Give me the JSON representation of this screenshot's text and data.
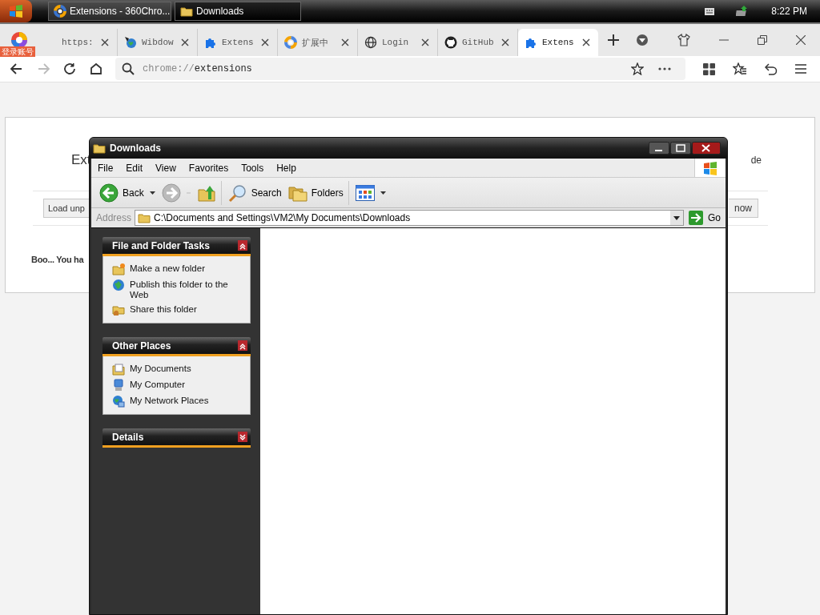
{
  "taskbar": {
    "tasks": [
      {
        "label": "Extensions - 360Chro...",
        "kind": "ring",
        "selected": false
      },
      {
        "label": "Downloads",
        "kind": "folder",
        "selected": true
      }
    ],
    "clock": "8:22 PM"
  },
  "browser": {
    "account_badge": "登录账号",
    "tabs": [
      {
        "label": "https:",
        "selected": false
      },
      {
        "label": "Wibdow",
        "kind": "globe-app",
        "selected": false
      },
      {
        "label": "Extens",
        "kind": "puzzle",
        "selected": false
      },
      {
        "label": "扩展中",
        "kind": "ring",
        "selected": false
      },
      {
        "label": "Login",
        "kind": "globe",
        "selected": false
      },
      {
        "label": "GitHub",
        "kind": "cat",
        "selected": false
      },
      {
        "label": "Extens",
        "kind": "puzzle",
        "selected": true
      }
    ],
    "nav": [
      {
        "kind": "back",
        "disabled": false
      },
      {
        "kind": "forward",
        "disabled": true
      },
      {
        "kind": "reload",
        "disabled": false
      },
      {
        "kind": "home",
        "disabled": false
      }
    ],
    "address": {
      "scheme": "chrome://",
      "path": "extensions"
    }
  },
  "page": {
    "title": "Ext",
    "toggle_label": "de",
    "buttons": [
      "Load unp",
      "now"
    ],
    "message": "Boo... You ha"
  },
  "explorer": {
    "title": "Downloads",
    "menu": [
      "File",
      "Edit",
      "View",
      "Favorites",
      "Tools",
      "Help"
    ],
    "toolbar": [
      {
        "kind": "back",
        "label": "Back"
      },
      {
        "kind": "forward"
      },
      {
        "kind": "up"
      },
      {
        "kind": "search",
        "label": "Search"
      },
      {
        "kind": "folders",
        "label": "Folders"
      },
      {
        "kind": "views"
      }
    ],
    "address_label": "Address",
    "address": "C:\\Documents and Settings\\VM2\\My Documents\\Downloads",
    "go": "Go",
    "panels": [
      {
        "title": "File and Folder Tasks",
        "expanded": true,
        "items": [
          {
            "label": "Make a new folder",
            "kind": "new-folder"
          },
          {
            "label": "Publish this folder to the Web",
            "kind": "web"
          },
          {
            "label": "Share this folder",
            "kind": "share"
          }
        ]
      },
      {
        "title": "Other Places",
        "expanded": true,
        "items": [
          {
            "label": "My Documents",
            "kind": "documents"
          },
          {
            "label": "My Computer",
            "kind": "computer"
          },
          {
            "label": "My Network Places",
            "kind": "network"
          }
        ]
      },
      {
        "title": "Details",
        "expanded": false
      }
    ]
  }
}
